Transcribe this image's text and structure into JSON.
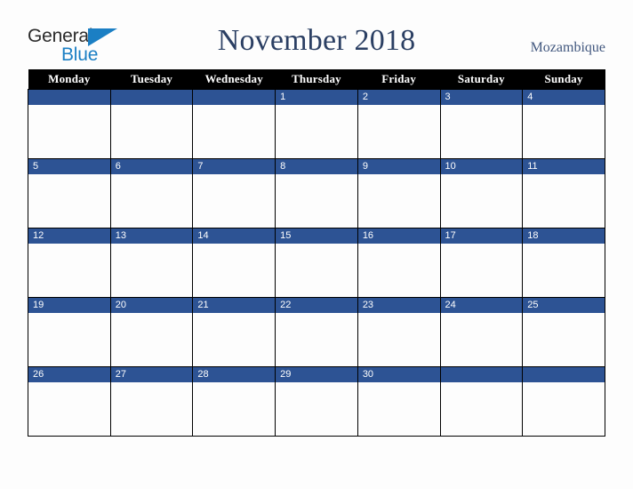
{
  "brand": {
    "name_part1": "General",
    "name_part2": "Blue",
    "triangle_color": "#1b7fc4"
  },
  "header": {
    "title": "November 2018",
    "country": "Mozambique",
    "title_color": "#2b3f63",
    "country_color": "#41577e"
  },
  "calendar": {
    "weekday_headers": [
      "Monday",
      "Tuesday",
      "Wednesday",
      "Thursday",
      "Friday",
      "Saturday",
      "Sunday"
    ],
    "header_bg": "#000000",
    "header_text_color": "#ffffff",
    "daynum_band_color": "#2d5394",
    "daynum_text_color": "#ffffff",
    "weeks": [
      [
        "",
        "",
        "",
        "1",
        "2",
        "3",
        "4"
      ],
      [
        "5",
        "6",
        "7",
        "8",
        "9",
        "10",
        "11"
      ],
      [
        "12",
        "13",
        "14",
        "15",
        "16",
        "17",
        "18"
      ],
      [
        "19",
        "20",
        "21",
        "22",
        "23",
        "24",
        "25"
      ],
      [
        "26",
        "27",
        "28",
        "29",
        "30",
        "",
        ""
      ]
    ]
  }
}
